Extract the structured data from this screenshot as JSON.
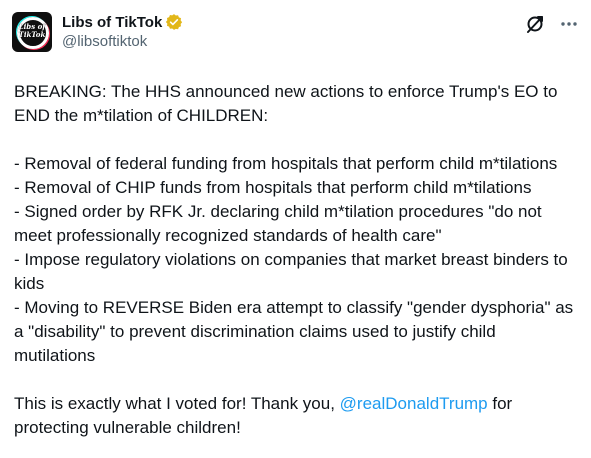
{
  "author": {
    "display_name": "Libs of TikTok",
    "handle": "@libsoftiktok",
    "avatar_text": "Libs of TikTok"
  },
  "icons": {
    "verified": "verified-badge-icon",
    "grok": "grok-icon",
    "more": "more-icon"
  },
  "colors": {
    "text": "#0f1419",
    "secondary": "#536471",
    "link": "#1d9bf0",
    "verified_badge": "#e2b719"
  },
  "tweet": {
    "headline": "BREAKING: The HHS announced new actions to enforce Trump's EO to END the m*tilation of CHILDREN:",
    "bullets": [
      "- Removal of federal funding from hospitals that perform child m*tilations",
      "- Removal of CHIP funds from hospitals that perform child m*tilations",
      "- Signed order by RFK Jr. declaring child m*tilation procedures \"do not meet professionally recognized standards of health care\"",
      "- Impose regulatory violations on companies that market breast binders to kids",
      "- Moving to REVERSE Biden era attempt to classify \"gender dysphoria\" as a \"disability\" to prevent discrimination claims used to justify child mutilations"
    ],
    "closing_before": "This is exactly what I voted for! Thank you, ",
    "mention": "@realDonaldTrump",
    "closing_after": " for protecting vulnerable children!"
  }
}
